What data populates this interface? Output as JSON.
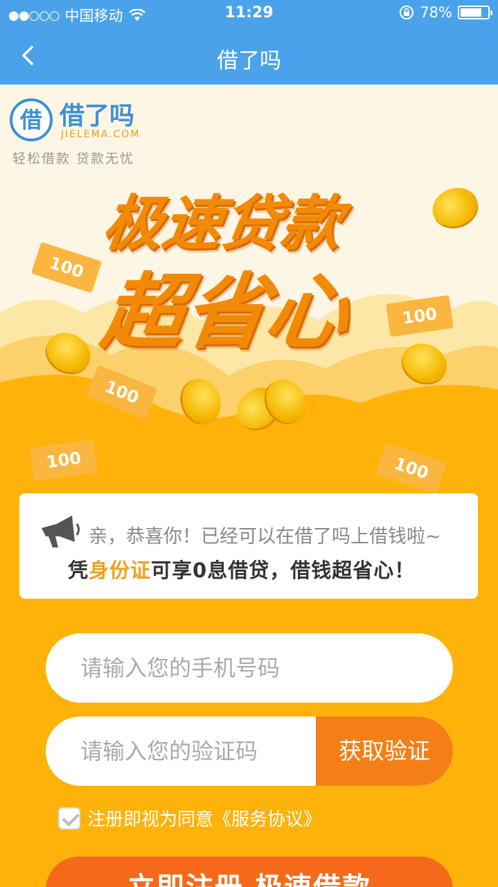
{
  "status_bar": {
    "signal": "●●○○○",
    "carrier": "中国移动",
    "time": "11:29",
    "battery": "78%",
    "battery_level": 0.78
  },
  "nav": {
    "title": "借了吗"
  },
  "logo": {
    "mark": "借",
    "name": "借了吗",
    "domain": "JIELEMA.COM",
    "slogan": "轻松借款 贷款无忧"
  },
  "hero": {
    "headline_1": "极速贷款",
    "headline_2": "超省心",
    "bill_value": "100"
  },
  "notice": {
    "line1": "亲，恭喜你！已经可以在借了吗上借钱啦~",
    "line2_prefix": "凭",
    "line2_highlight": "身份证",
    "line2_suffix": "可享0息借贷，借钱超省心！"
  },
  "form": {
    "phone_placeholder": "请输入您的手机号码",
    "code_placeholder": "请输入您的验证码",
    "get_code_label": "获取验证",
    "agree_text": "注册即视为同意《服务协议》",
    "submit_label": "立即注册 极速借款"
  },
  "colors": {
    "nav_blue": "#4aa3ea",
    "background_orange": "#ffb20a",
    "button_orange": "#f57f17",
    "headline_orange": "#f28a07"
  }
}
